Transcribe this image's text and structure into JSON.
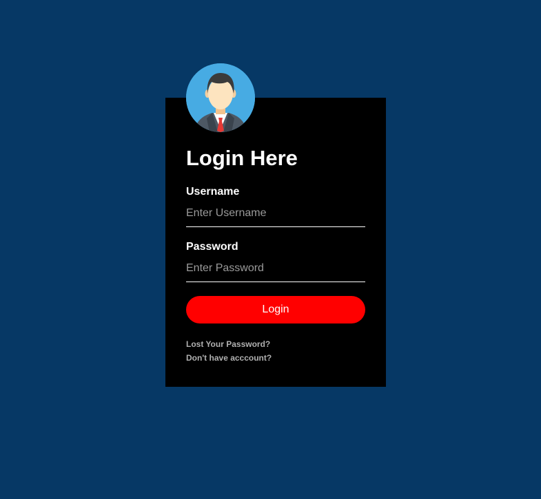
{
  "page": {
    "background_color": "#063865"
  },
  "login": {
    "title": "Login Here",
    "avatar_icon": "user-avatar-icon",
    "username": {
      "label": "Username",
      "placeholder": "Enter Username",
      "value": ""
    },
    "password": {
      "label": "Password",
      "placeholder": "Enter Password",
      "value": ""
    },
    "submit_label": "Login",
    "links": {
      "lost_password": "Lost Your Password?",
      "no_account": "Don't have acccount?"
    },
    "colors": {
      "box": "#000000",
      "button": "#ff0000",
      "avatar_bg": "#47abe3"
    }
  }
}
